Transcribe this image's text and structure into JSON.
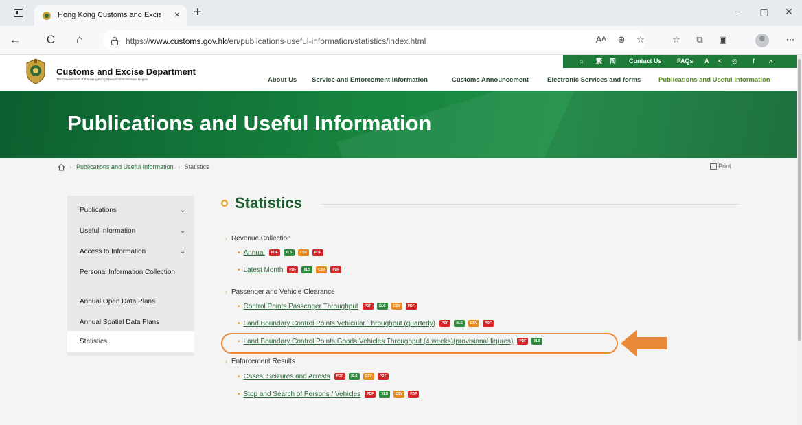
{
  "browser": {
    "tab_title": "Hong Kong Customs and Excise",
    "tab_close": "×",
    "new_tab": "+",
    "window_controls": [
      "−",
      "▢",
      "✕"
    ],
    "url_prefix": "https://",
    "url_domain": "www.customs.gov.hk",
    "url_path": "/en/publications-useful-information/statistics/index.html",
    "nav_icons": [
      "←",
      "C",
      "⌂"
    ],
    "addr_icons": [
      "Aᴬ",
      "⊕",
      "☆",
      "☆",
      "⧉",
      "▣",
      "⋯"
    ]
  },
  "header": {
    "dept_name": "Customs and Excise Department",
    "dept_sub": "The Government of the Hong Kong Special Administrative Region",
    "utility": {
      "home": "⌂",
      "lang1": "繁",
      "lang2": "简",
      "contact": "Contact Us",
      "faqs": "FAQs",
      "font": "A",
      "share": "<",
      "instagram": "◎",
      "facebook": "f",
      "search": "⌕"
    },
    "nav": [
      "About Us",
      "Service and Enforcement Information",
      "Customs Announcement",
      "Electronic Services and forms",
      "Publications and Useful Information"
    ]
  },
  "banner": {
    "title": "Publications and Useful Information"
  },
  "breadcrumb": {
    "sep": "›",
    "link": "Publications and Useful Information",
    "current": "Statistics"
  },
  "print_label": "Print",
  "sidenav": {
    "chevron": "⌄",
    "items": [
      {
        "label": "Publications"
      },
      {
        "label": "Useful Information"
      },
      {
        "label": "Access to Information"
      },
      {
        "label": "Personal Information Collection"
      },
      {
        "label": "Annual Open Data Plans"
      },
      {
        "label": "Annual Spatial Data Plans"
      },
      {
        "label": "Statistics"
      }
    ]
  },
  "content": {
    "heading": "Statistics",
    "section_chev": "›",
    "bullet": "•",
    "file_labels": {
      "pdf": "PDF",
      "xls": "XLS",
      "csv": "CSV"
    },
    "sections": [
      {
        "title": "Revenue Collection",
        "links": [
          {
            "label": "Annual"
          },
          {
            "label": "Latest Month"
          }
        ]
      },
      {
        "title": "Passenger and Vehicle Clearance",
        "links": [
          {
            "label": "Control Points Passenger Throughput"
          },
          {
            "label": "Land Boundary Control Points Vehicular Throughput (quarterly)"
          },
          {
            "label": "Land Boundary Control Points Goods Vehicles Throughput (4 weeks)(provisional figures)"
          }
        ]
      },
      {
        "title": "Enforcement Results",
        "links": [
          {
            "label": "Cases, Seizures and Arrests"
          },
          {
            "label": "Stop and Search of Persons / Vehicles"
          }
        ]
      }
    ]
  },
  "colors": {
    "brand_green": "#1e7b3a",
    "link_green": "#2b6a3a",
    "accent_orange": "#e59a1a",
    "highlight_orange": "#e98a3a"
  }
}
